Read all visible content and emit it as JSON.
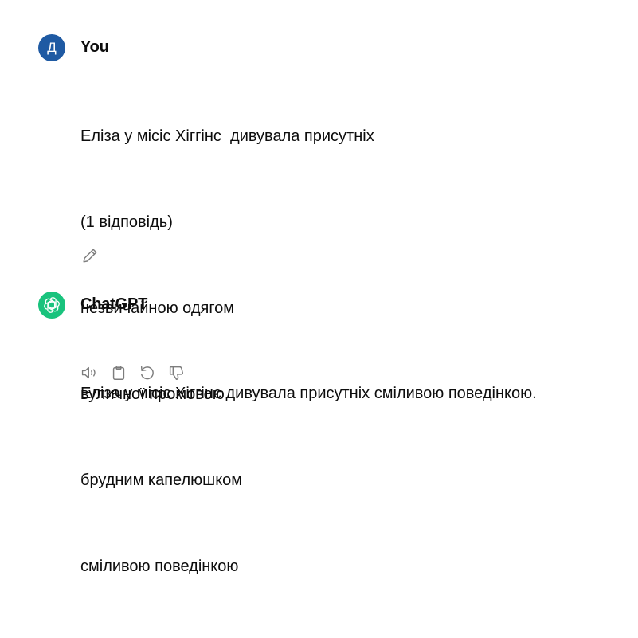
{
  "user_message": {
    "avatar_letter": "Д",
    "author": "You",
    "lines": [
      "Еліза у місіс Хіггінс  дивувала присутніх",
      "(1 відповідь)",
      "незвичайною одягом",
      "вуличної промовою",
      "брудним капелюшком",
      "сміливою поведінкою"
    ],
    "icons": {
      "edit": "pencil-icon"
    }
  },
  "assistant_message": {
    "author": "ChatGPT",
    "text": "Еліза у місіс Хіггінс дивувала присутніх сміливою поведінкою.",
    "icons": [
      "speaker-icon",
      "clipboard-icon",
      "regenerate-icon",
      "thumbs-down-icon"
    ]
  },
  "colors": {
    "user_avatar": "#1f5aa3",
    "assistant_avatar": "#19c37d",
    "icon": "#7d7d7d",
    "text": "#0d0d0d"
  }
}
